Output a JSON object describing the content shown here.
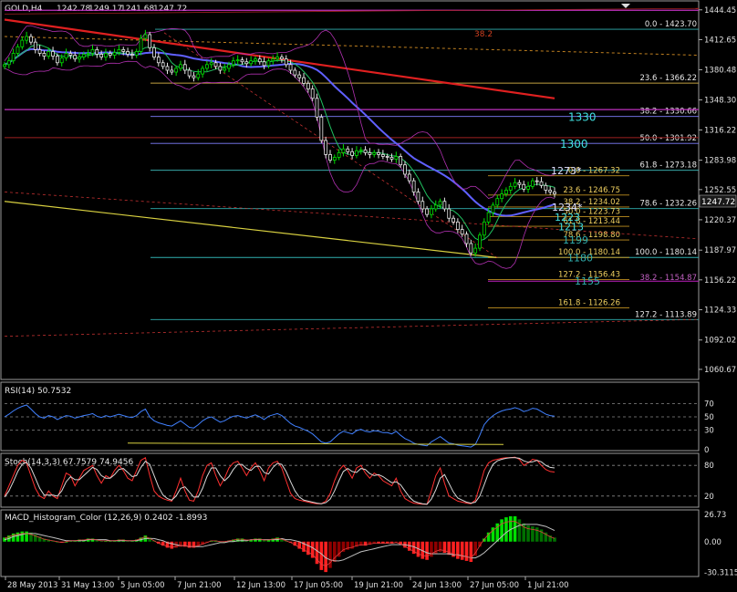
{
  "chart_data": [
    {
      "type": "candlestick",
      "title": "GOLD,H4",
      "ohlc": [
        "1242.78",
        "1249.17",
        "1241.68",
        "1247.72"
      ],
      "current_price": "1247.72",
      "ylim": [
        1049.9,
        1453.0
      ],
      "y_ticks": [
        "1444.45",
        "1412.65",
        "1380.48",
        "1348.30",
        "1316.22",
        "1283.98",
        "1252.55",
        "1220.37",
        "1187.97",
        "1156.22",
        "1124.33",
        "1092.02",
        "1060.67"
      ],
      "x_ticks": [
        "28 May 2013",
        "31 May 13:00",
        "5 Jun 05:00",
        "7 Jun 21:00",
        "12 Jun 13:00",
        "17 Jun 05:00",
        "19 Jun 21:00",
        "24 Jun 13:00",
        "27 Jun 05:00",
        "1 Jul 21:00"
      ],
      "closes": [
        1386,
        1390,
        1398,
        1405,
        1412,
        1416,
        1410,
        1402,
        1398,
        1395,
        1400,
        1395,
        1388,
        1393,
        1398,
        1396,
        1392,
        1394,
        1397,
        1398,
        1402,
        1397,
        1394,
        1398,
        1396,
        1399,
        1402,
        1400,
        1397,
        1396,
        1400,
        1414,
        1418,
        1404,
        1394,
        1388,
        1384,
        1380,
        1378,
        1382,
        1386,
        1380,
        1374,
        1372,
        1376,
        1382,
        1386,
        1388,
        1384,
        1380,
        1382,
        1386,
        1390,
        1391,
        1389,
        1387,
        1390,
        1392,
        1389,
        1385,
        1390,
        1392,
        1394,
        1392,
        1386,
        1380,
        1375,
        1372,
        1366,
        1360,
        1350,
        1330,
        1305,
        1290,
        1284,
        1287,
        1292,
        1296,
        1293,
        1289,
        1294,
        1295,
        1292,
        1290,
        1292,
        1290,
        1288,
        1287,
        1285,
        1288,
        1279,
        1269,
        1262,
        1250,
        1240,
        1232,
        1226,
        1232,
        1236,
        1240,
        1232,
        1222,
        1218,
        1210,
        1205,
        1195,
        1185,
        1190,
        1204,
        1218,
        1228,
        1236,
        1243,
        1248,
        1252,
        1256,
        1260,
        1258,
        1253,
        1256,
        1262,
        1261,
        1257,
        1252,
        1250,
        1248
      ],
      "fib_levels": [
        {
          "label": "0.0 - 1423.70",
          "value": 1423.7
        },
        {
          "label": "23.6 - 1366.22",
          "value": 1366.22
        },
        {
          "label": "38.2 - 1330.66",
          "value": 1330.66
        },
        {
          "label": "50.0 - 1301.92",
          "value": 1301.92
        },
        {
          "label": "61.8 - 1273.18",
          "value": 1273.18
        },
        {
          "label": "78.6 - 1232.26",
          "value": 1232.26
        },
        {
          "label": "100.0 - 1180.14",
          "value": 1180.14
        },
        {
          "label": "127.2 - 1113.89",
          "value": 1113.89
        }
      ],
      "fib_levels_2": [
        {
          "label": "0.0 - 1267.32",
          "value": 1267.32
        },
        {
          "label": "23.6 - 1246.75",
          "value": 1246.75
        },
        {
          "label": "38.2 - 1234.02",
          "value": 1234.02
        },
        {
          "label": "50.0 - 1223.73",
          "value": 1223.73
        },
        {
          "label": "61.8 - 1213.44",
          "value": 1213.44
        },
        {
          "label": "78.6 - 1198.80",
          "value": 1198.8
        },
        {
          "label": "100.0 - 1180.14",
          "value": 1180.14
        },
        {
          "label": "127.2 - 1156.43",
          "value": 1156.43
        },
        {
          "label": "161.8 - 1126.26",
          "value": 1126.26
        }
      ],
      "ext_label": "38.2 - 1154.87",
      "top_label": "38.2",
      "annotations": [
        "1330",
        "1300",
        "1273*",
        "1234*",
        "1223",
        "1213",
        "1199",
        "1180",
        "1155"
      ]
    },
    {
      "type": "line",
      "title": "RSI(14) 50.7532",
      "ylim": [
        0,
        100
      ],
      "y_ticks": [
        "70",
        "50",
        "30",
        "0"
      ],
      "levels": [
        70,
        50,
        30
      ],
      "values": [
        50,
        54,
        59,
        63,
        66,
        68,
        62,
        55,
        50,
        48,
        52,
        50,
        46,
        49,
        52,
        51,
        48,
        50,
        52,
        53,
        55,
        51,
        49,
        52,
        50,
        52,
        54,
        52,
        50,
        49,
        52,
        58,
        62,
        50,
        44,
        41,
        39,
        37,
        36,
        40,
        44,
        39,
        34,
        33,
        38,
        44,
        48,
        50,
        46,
        42,
        44,
        48,
        51,
        52,
        50,
        48,
        51,
        53,
        50,
        46,
        51,
        53,
        55,
        52,
        46,
        40,
        36,
        34,
        31,
        28,
        24,
        18,
        12,
        10,
        12,
        18,
        24,
        28,
        26,
        24,
        29,
        31,
        28,
        27,
        29,
        28,
        26,
        26,
        24,
        28,
        22,
        17,
        14,
        10,
        8,
        7,
        6,
        12,
        16,
        20,
        15,
        10,
        9,
        7,
        6,
        5,
        4,
        8,
        22,
        38,
        46,
        52,
        56,
        59,
        61,
        62,
        64,
        62,
        58,
        60,
        63,
        62,
        58,
        54,
        52,
        51
      ]
    },
    {
      "type": "line",
      "title": "Stoch(14,3,3) 67.7579 74.9456",
      "ylim": [
        0,
        100
      ],
      "y_ticks": [
        "80",
        "20"
      ],
      "levels": [
        80,
        20
      ],
      "series": [
        {
          "name": "",
          "color": "#ff3030",
          "values": [
            20,
            40,
            60,
            80,
            90,
            85,
            60,
            35,
            20,
            15,
            30,
            20,
            15,
            40,
            65,
            60,
            40,
            55,
            70,
            75,
            80,
            60,
            45,
            60,
            55,
            70,
            80,
            70,
            55,
            50,
            70,
            90,
            95,
            60,
            30,
            20,
            15,
            12,
            10,
            30,
            55,
            30,
            12,
            10,
            30,
            60,
            80,
            85,
            60,
            40,
            55,
            75,
            85,
            88,
            75,
            60,
            75,
            85,
            70,
            50,
            75,
            85,
            88,
            75,
            50,
            25,
            15,
            12,
            10,
            8,
            6,
            5,
            5,
            10,
            25,
            50,
            70,
            80,
            70,
            55,
            75,
            80,
            65,
            55,
            65,
            60,
            50,
            45,
            40,
            55,
            30,
            15,
            10,
            6,
            5,
            4,
            4,
            30,
            60,
            75,
            45,
            20,
            15,
            10,
            8,
            6,
            5,
            12,
            40,
            70,
            85,
            90,
            92,
            94,
            95,
            95,
            96,
            92,
            80,
            85,
            92,
            90,
            80,
            72,
            68,
            67
          ]
        },
        {
          "name": "",
          "color": "#d8d8d8",
          "values": [
            18,
            30,
            48,
            68,
            82,
            86,
            75,
            55,
            35,
            22,
            22,
            22,
            20,
            30,
            48,
            58,
            52,
            52,
            60,
            68,
            76,
            72,
            60,
            55,
            55,
            62,
            72,
            74,
            66,
            58,
            60,
            76,
            88,
            82,
            60,
            38,
            22,
            15,
            12,
            20,
            35,
            38,
            28,
            18,
            18,
            35,
            58,
            75,
            75,
            60,
            50,
            58,
            72,
            82,
            82,
            74,
            70,
            78,
            78,
            66,
            63,
            76,
            84,
            82,
            68,
            48,
            30,
            18,
            12,
            10,
            8,
            6,
            5,
            7,
            14,
            30,
            50,
            68,
            74,
            68,
            66,
            74,
            72,
            64,
            60,
            62,
            58,
            52,
            46,
            48,
            42,
            30,
            18,
            10,
            7,
            5,
            4,
            14,
            32,
            55,
            62,
            45,
            28,
            16,
            12,
            8,
            6,
            8,
            20,
            42,
            65,
            82,
            89,
            92,
            94,
            95,
            95,
            94,
            89,
            86,
            87,
            90,
            87,
            80,
            76,
            75
          ]
        }
      ]
    },
    {
      "type": "bar",
      "title": "MACD_Histogram_Color (12,26,9) 0.2402 -1.8993",
      "ylim": [
        -33.5,
        29.5
      ],
      "y_ticks": [
        "26.73",
        "0.00",
        "-30.3115"
      ],
      "values": [
        4,
        6,
        8,
        9,
        10,
        10,
        9,
        7,
        5,
        3,
        2,
        1,
        0,
        -1,
        0,
        1,
        1,
        2,
        2,
        3,
        3,
        2,
        1,
        1,
        1,
        1,
        2,
        2,
        1,
        1,
        2,
        4,
        6,
        4,
        1,
        -2,
        -4,
        -6,
        -7,
        -6,
        -5,
        -5,
        -6,
        -6,
        -5,
        -3,
        -1,
        1,
        1,
        0,
        0,
        1,
        2,
        3,
        3,
        2,
        2,
        3,
        3,
        2,
        2,
        3,
        4,
        3,
        1,
        -1,
        -4,
        -7,
        -10,
        -13,
        -16,
        -22,
        -28,
        -30,
        -26,
        -20,
        -15,
        -10,
        -8,
        -7,
        -5,
        -4,
        -4,
        -3,
        -2,
        -2,
        -2,
        -2,
        -2,
        -1,
        -3,
        -6,
        -9,
        -12,
        -15,
        -17,
        -18,
        -15,
        -12,
        -10,
        -11,
        -13,
        -15,
        -17,
        -18,
        -19,
        -20,
        -14,
        -5,
        3,
        9,
        14,
        18,
        22,
        24,
        25,
        25,
        22,
        18,
        16,
        15,
        14,
        12,
        9,
        6,
        4
      ],
      "signal": [
        2,
        3,
        5,
        6,
        7,
        8,
        8,
        8,
        7,
        6,
        5,
        4,
        3,
        2,
        1,
        1,
        1,
        1,
        1,
        2,
        2,
        2,
        2,
        2,
        1,
        1,
        1,
        1,
        1,
        1,
        1,
        2,
        3,
        3,
        3,
        2,
        1,
        -1,
        -2,
        -3,
        -4,
        -4,
        -5,
        -5,
        -5,
        -5,
        -4,
        -3,
        -2,
        -1,
        -1,
        0,
        0,
        1,
        1,
        1,
        2,
        2,
        2,
        2,
        2,
        2,
        2,
        3,
        2,
        2,
        1,
        0,
        -2,
        -4,
        -6,
        -9,
        -12,
        -16,
        -18,
        -19,
        -19,
        -18,
        -16,
        -14,
        -12,
        -10,
        -9,
        -8,
        -7,
        -6,
        -5,
        -4,
        -3,
        -3,
        -3,
        -3,
        -4,
        -5,
        -7,
        -9,
        -11,
        -12,
        -12,
        -12,
        -12,
        -12,
        -13,
        -13,
        -14,
        -15,
        -16,
        -16,
        -14,
        -11,
        -7,
        -3,
        1,
        5,
        9,
        12,
        14,
        16,
        17,
        17,
        17,
        17,
        16,
        15,
        13,
        11
      ]
    }
  ]
}
